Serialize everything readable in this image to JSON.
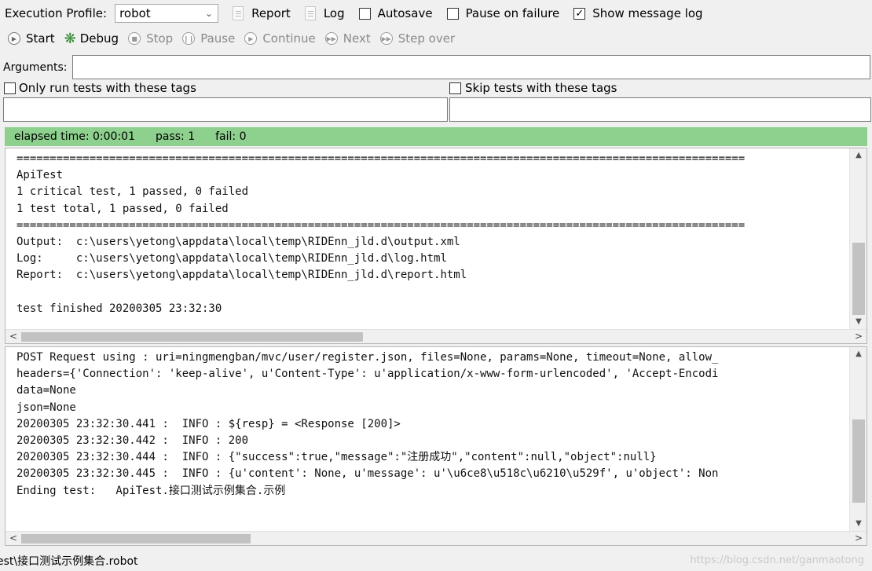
{
  "toolbar": {
    "profile_label": "Execution Profile:",
    "profile_value": "robot",
    "report_label": "Report",
    "log_label": "Log",
    "autosave_label": "Autosave",
    "pause_on_failure_label": "Pause on failure",
    "show_message_log_label": "Show message log",
    "autosave_checked": false,
    "pause_on_failure_checked": false,
    "show_message_log_checked": true
  },
  "run_buttons": {
    "start": "Start",
    "debug": "Debug",
    "stop": "Stop",
    "pause": "Pause",
    "continue": "Continue",
    "next": "Next",
    "step_over": "Step over"
  },
  "arguments": {
    "label": "Arguments:",
    "value": ""
  },
  "tags": {
    "include_label": "Only run tests with these tags",
    "exclude_label": "Skip tests with these tags",
    "include_value": "",
    "exclude_value": ""
  },
  "status": {
    "elapsed": "elapsed time: 0:00:01",
    "pass": "pass: 1",
    "fail": "fail: 0",
    "color": "#8ed08e"
  },
  "output_log": "==============================================================================================================\nApiTest\n1 critical test, 1 passed, 0 failed\n1 test total, 1 passed, 0 failed\n==============================================================================================================\nOutput:  c:\\users\\yetong\\appdata\\local\\temp\\RIDEnn_jld.d\\output.xml\nLog:     c:\\users\\yetong\\appdata\\local\\temp\\RIDEnn_jld.d\\log.html\nReport:  c:\\users\\yetong\\appdata\\local\\temp\\RIDEnn_jld.d\\report.html\n\ntest finished 20200305 23:32:30",
  "message_log": "POST Request using : uri=ningmengban/mvc/user/register.json, files=None, params=None, timeout=None, allow_\nheaders={'Connection': 'keep-alive', u'Content-Type': u'application/x-www-form-urlencoded', 'Accept-Encodi\ndata=None\njson=None\n20200305 23:32:30.441 :  INFO : ${resp} = <Response [200]>\n20200305 23:32:30.442 :  INFO : 200\n20200305 23:32:30.444 :  INFO : {\"success\":true,\"message\":\"注册成功\",\"content\":null,\"object\":null}\n20200305 23:32:30.445 :  INFO : {u'content': None, u'message': u'\\u6ce8\\u518c\\u6210\\u529f', u'object': Non\nEnding test:   ApiTest.接口测试示例集合.示例",
  "bottom": {
    "path": "est\\接口测试示例集合.robot",
    "watermark": "https://blog.csdn.net/ganmaotong"
  }
}
